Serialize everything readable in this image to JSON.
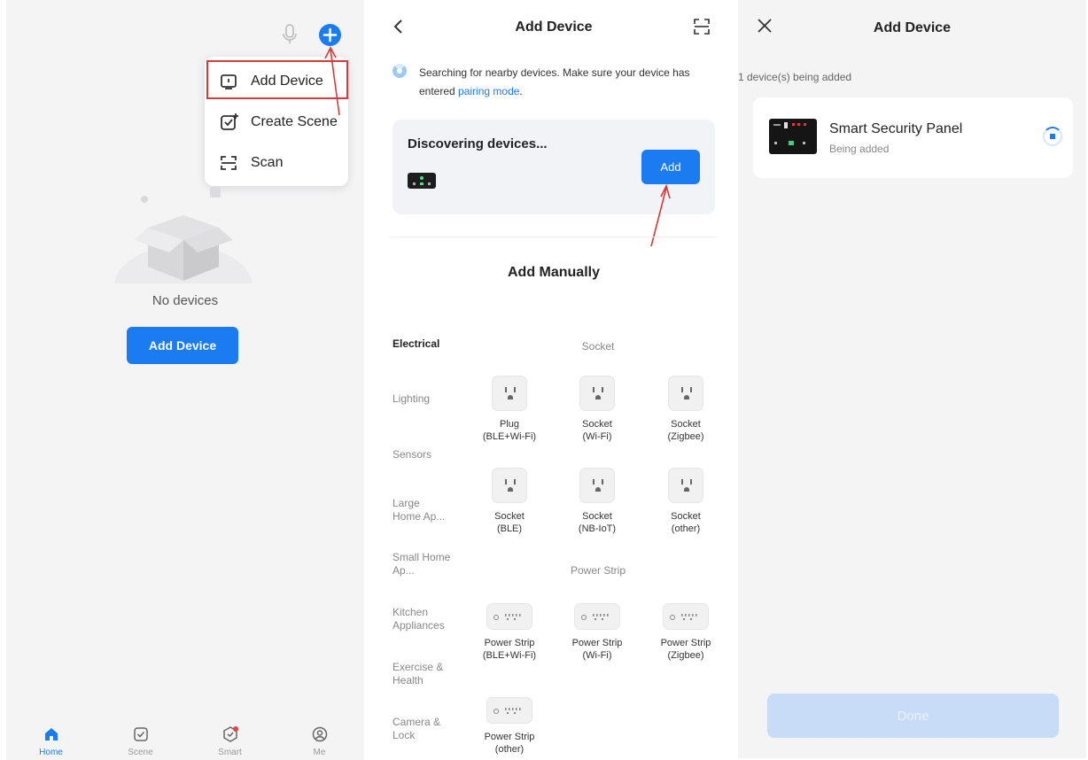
{
  "home": {
    "menu": {
      "add_device": "Add Device",
      "create_scene": "Create Scene",
      "scan": "Scan"
    },
    "empty_text": "No devices",
    "add_device_button": "Add Device",
    "tabs": [
      {
        "label": "Home",
        "icon": "home-icon",
        "active": true
      },
      {
        "label": "Scene",
        "icon": "scene-check-icon",
        "active": false
      },
      {
        "label": "Smart",
        "icon": "smart-icon",
        "active": false
      },
      {
        "label": "Me",
        "icon": "profile-icon",
        "active": false
      }
    ]
  },
  "add_device": {
    "title": "Add Device",
    "search_text": "Searching for nearby devices. Make sure your device has entered ",
    "pairing_link": "pairing mode",
    "search_suffix": ".",
    "discovering_title": "Discovering devices...",
    "add_button": "Add",
    "add_manually_title": "Add Manually",
    "categories": [
      "Electrical",
      "Lighting",
      "Sensors",
      "Large Home Ap...",
      "Small Home Ap...",
      "Kitchen Appliances",
      "Exercise & Health",
      "Camera & Lock"
    ],
    "sections": {
      "socket": "Socket",
      "power_strip": "Power Strip"
    },
    "socket_products": [
      [
        "Plug",
        "(BLE+Wi-Fi)"
      ],
      [
        "Socket",
        "(Wi-Fi)"
      ],
      [
        "Socket",
        "(Zigbee)"
      ],
      [
        "Socket",
        "(BLE)"
      ],
      [
        "Socket",
        "(NB-IoT)"
      ],
      [
        "Socket",
        "(other)"
      ]
    ],
    "strip_products": [
      [
        "Power Strip",
        "(BLE+Wi-Fi)"
      ],
      [
        "Power Strip",
        "(Wi-Fi)"
      ],
      [
        "Power Strip",
        "(Zigbee)"
      ],
      [
        "Power Strip",
        "(other)"
      ]
    ]
  },
  "adding": {
    "title": "Add Device",
    "count_text": "1 device(s) being added",
    "device_name": "Smart Security Panel",
    "device_status": "Being added",
    "done_button": "Done"
  },
  "colors": {
    "accent": "#1a7cf0",
    "annotation_red": "#d63a3a"
  }
}
